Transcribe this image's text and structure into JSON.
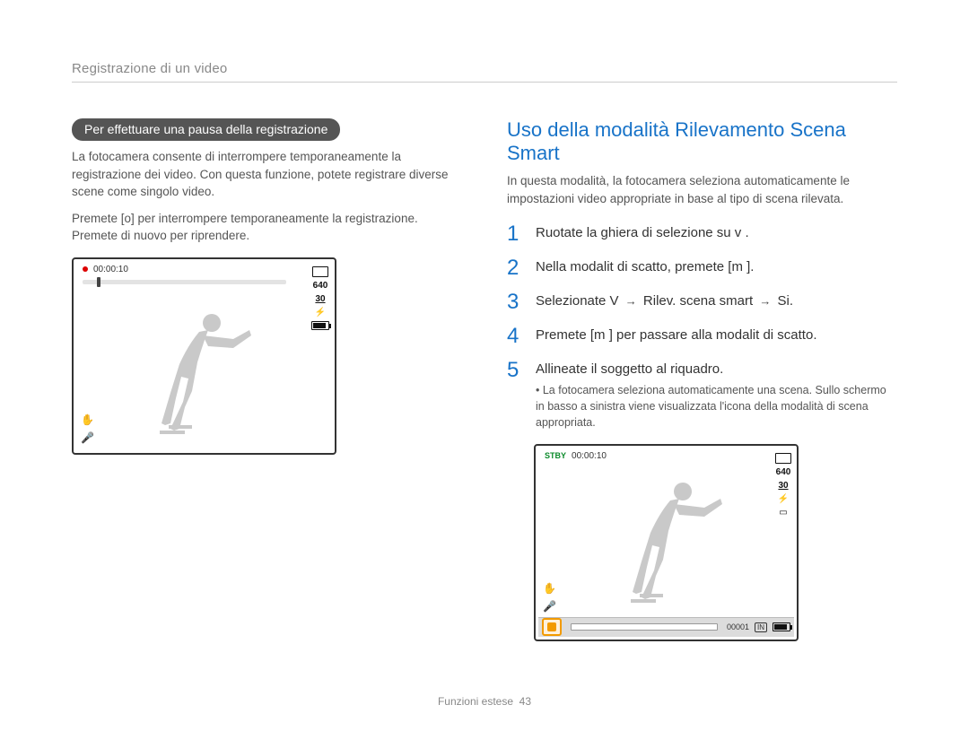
{
  "breadcrumb": "Registrazione di un video",
  "left": {
    "pill_title": "Per effettuare una pausa della registrazione",
    "para1": "La fotocamera consente di interrompere temporaneamente la registrazione dei video. Con questa funzione, potete registrare diverse scene come singolo video.",
    "para2_pre": "Premete [",
    "para2_key": "o",
    "para2_post": "] per interrompere temporaneamente la registrazione. Premete di nuovo per riprendere."
  },
  "lcd_left": {
    "time": "00:00:10",
    "res": "640",
    "fps": "30"
  },
  "right": {
    "heading": "Uso della modalità Rilevamento Scena Smart",
    "intro": "In questa modalità, la fotocamera seleziona automaticamente le impostazioni video appropriate in base al tipo di scena rilevata."
  },
  "steps": {
    "s1": "Ruotate la ghiera di selezione su v    .",
    "s2_pre": "Nella modalit   di scatto, premete [",
    "s2_key": "m",
    "s2_post": "        ].",
    "s3_pre": "Selezionate V    ",
    "s3_mid": " Rilev. scena smart ",
    "s3_end": " Si.",
    "s4_pre": "Premete [",
    "s4_key": "m",
    "s4_post": "       ] per passare alla modalit   di scatto.",
    "s5": "Allineate il soggetto al riquadro.",
    "s5_bullet": "La fotocamera seleziona automaticamente una scena. Sullo schermo in basso a sinistra viene visualizzata l'icona della modalità di scena appropriata."
  },
  "lcd_right": {
    "stby": "STBY",
    "time": "00:00:10",
    "res": "640",
    "fps": "30",
    "counter": "00001"
  },
  "footer": {
    "section": "Funzioni estese",
    "page": "43"
  }
}
